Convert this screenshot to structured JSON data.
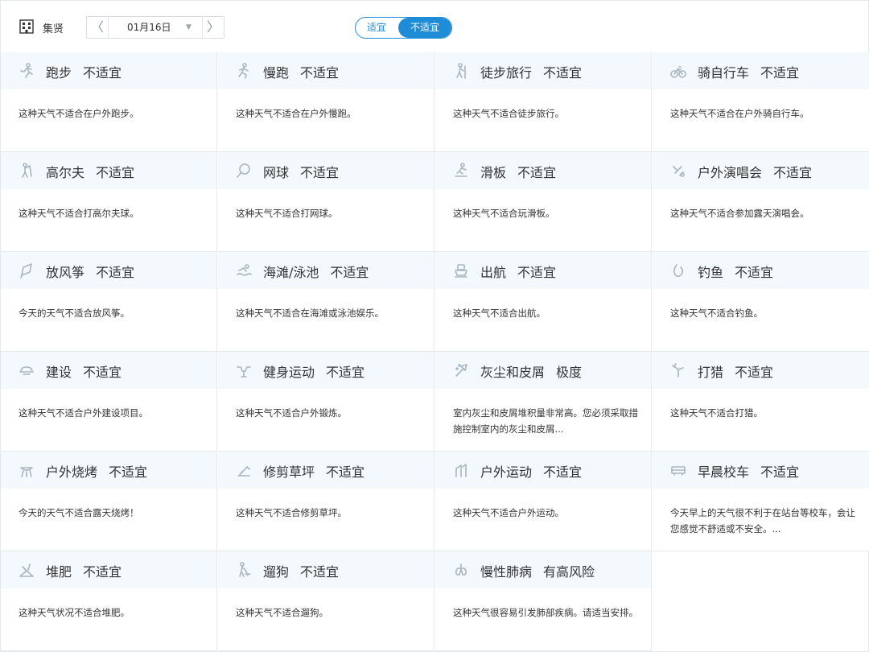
{
  "header": {
    "location": "集贤",
    "date": "01月16日",
    "prev_arrow": "〈",
    "next_arrow": "〉",
    "caret": "▼",
    "toggle": [
      "适宜",
      "不适宜"
    ],
    "toggle_selected": "不适宜",
    "accent": "#1f8cd8"
  },
  "cards": [
    {
      "name": "跑步",
      "level": "不适宜",
      "desc": "这种天气不适合在户外跑步。",
      "icon": "running-icon"
    },
    {
      "name": "慢跑",
      "level": "不适宜",
      "desc": "这种天气不适合在户外慢跑。",
      "icon": "jogging-icon"
    },
    {
      "name": "徒步旅行",
      "level": "不适宜",
      "desc": "这种天气不适合徒步旅行。",
      "icon": "hiking-icon"
    },
    {
      "name": "骑自行车",
      "level": "不适宜",
      "desc": "这种天气不适合在户外骑自行车。",
      "icon": "bicycle-icon"
    },
    {
      "name": "高尔夫",
      "level": "不适宜",
      "desc": "这种天气不适合打高尔夫球。",
      "icon": "golf-icon"
    },
    {
      "name": "网球",
      "level": "不适宜",
      "desc": "这种天气不适合打网球。",
      "icon": "tennis-icon"
    },
    {
      "name": "滑板",
      "level": "不适宜",
      "desc": "这种天气不适合玩滑板。",
      "icon": "skateboard-icon"
    },
    {
      "name": "户外演唱会",
      "level": "不适宜",
      "desc": "这种天气不适合参加露天演唱会。",
      "icon": "concert-icon"
    },
    {
      "name": "放风筝",
      "level": "不适宜",
      "desc": "今天的天气不适合放风筝。",
      "icon": "kite-icon"
    },
    {
      "name": "海滩/泳池",
      "level": "不适宜",
      "desc": "这种天气不适合在海滩或泳池娱乐。",
      "icon": "swimming-icon"
    },
    {
      "name": "出航",
      "level": "不适宜",
      "desc": "这种天气不适合出航。",
      "icon": "boat-icon"
    },
    {
      "name": "钓鱼",
      "level": "不适宜",
      "desc": "这种天气不适合钓鱼。",
      "icon": "fishing-icon"
    },
    {
      "name": "建设",
      "level": "不适宜",
      "desc": "这种天气不适合户外建设项目。",
      "icon": "construction-icon"
    },
    {
      "name": "健身运动",
      "level": "不适宜",
      "desc": "这种天气不适合户外锻炼。",
      "icon": "fitness-icon"
    },
    {
      "name": "灰尘和皮屑",
      "level": "极度",
      "desc": "室内灰尘和皮屑堆积量非常高。您必须采取措施控制室内的灰尘和皮屑...",
      "icon": "dust-icon"
    },
    {
      "name": "打猎",
      "level": "不适宜",
      "desc": "这种天气不适合打猎。",
      "icon": "hunting-icon"
    },
    {
      "name": "户外烧烤",
      "level": "不适宜",
      "desc": "今天的天气不适合露天烧烤！",
      "icon": "bbq-icon"
    },
    {
      "name": "修剪草坪",
      "level": "不适宜",
      "desc": "这种天气不适合修剪草坪。",
      "icon": "lawn-mowing-icon"
    },
    {
      "name": "户外运动",
      "level": "不适宜",
      "desc": "这种天气不适合户外运动。",
      "icon": "outdoor-sport-icon"
    },
    {
      "name": "早晨校车",
      "level": "不适宜",
      "desc": "今天早上的天气很不利于在站台等校车，会让您感觉不舒适或不安全。...",
      "icon": "school-bus-icon"
    },
    {
      "name": "堆肥",
      "level": "不适宜",
      "desc": "这种天气状况不适合堆肥。",
      "icon": "compost-icon"
    },
    {
      "name": "遛狗",
      "level": "不适宜",
      "desc": "这种天气不适合遛狗。",
      "icon": "dog-walking-icon"
    },
    {
      "name": "慢性肺病",
      "level": "有高风险",
      "desc": "这种天气很容易引发肺部疾病。请适当安排。",
      "icon": "lung-icon"
    }
  ],
  "colors": {
    "head_bg": "#f3f9fd",
    "icon": "#a9b5c0",
    "border": "#e5e9ee"
  }
}
